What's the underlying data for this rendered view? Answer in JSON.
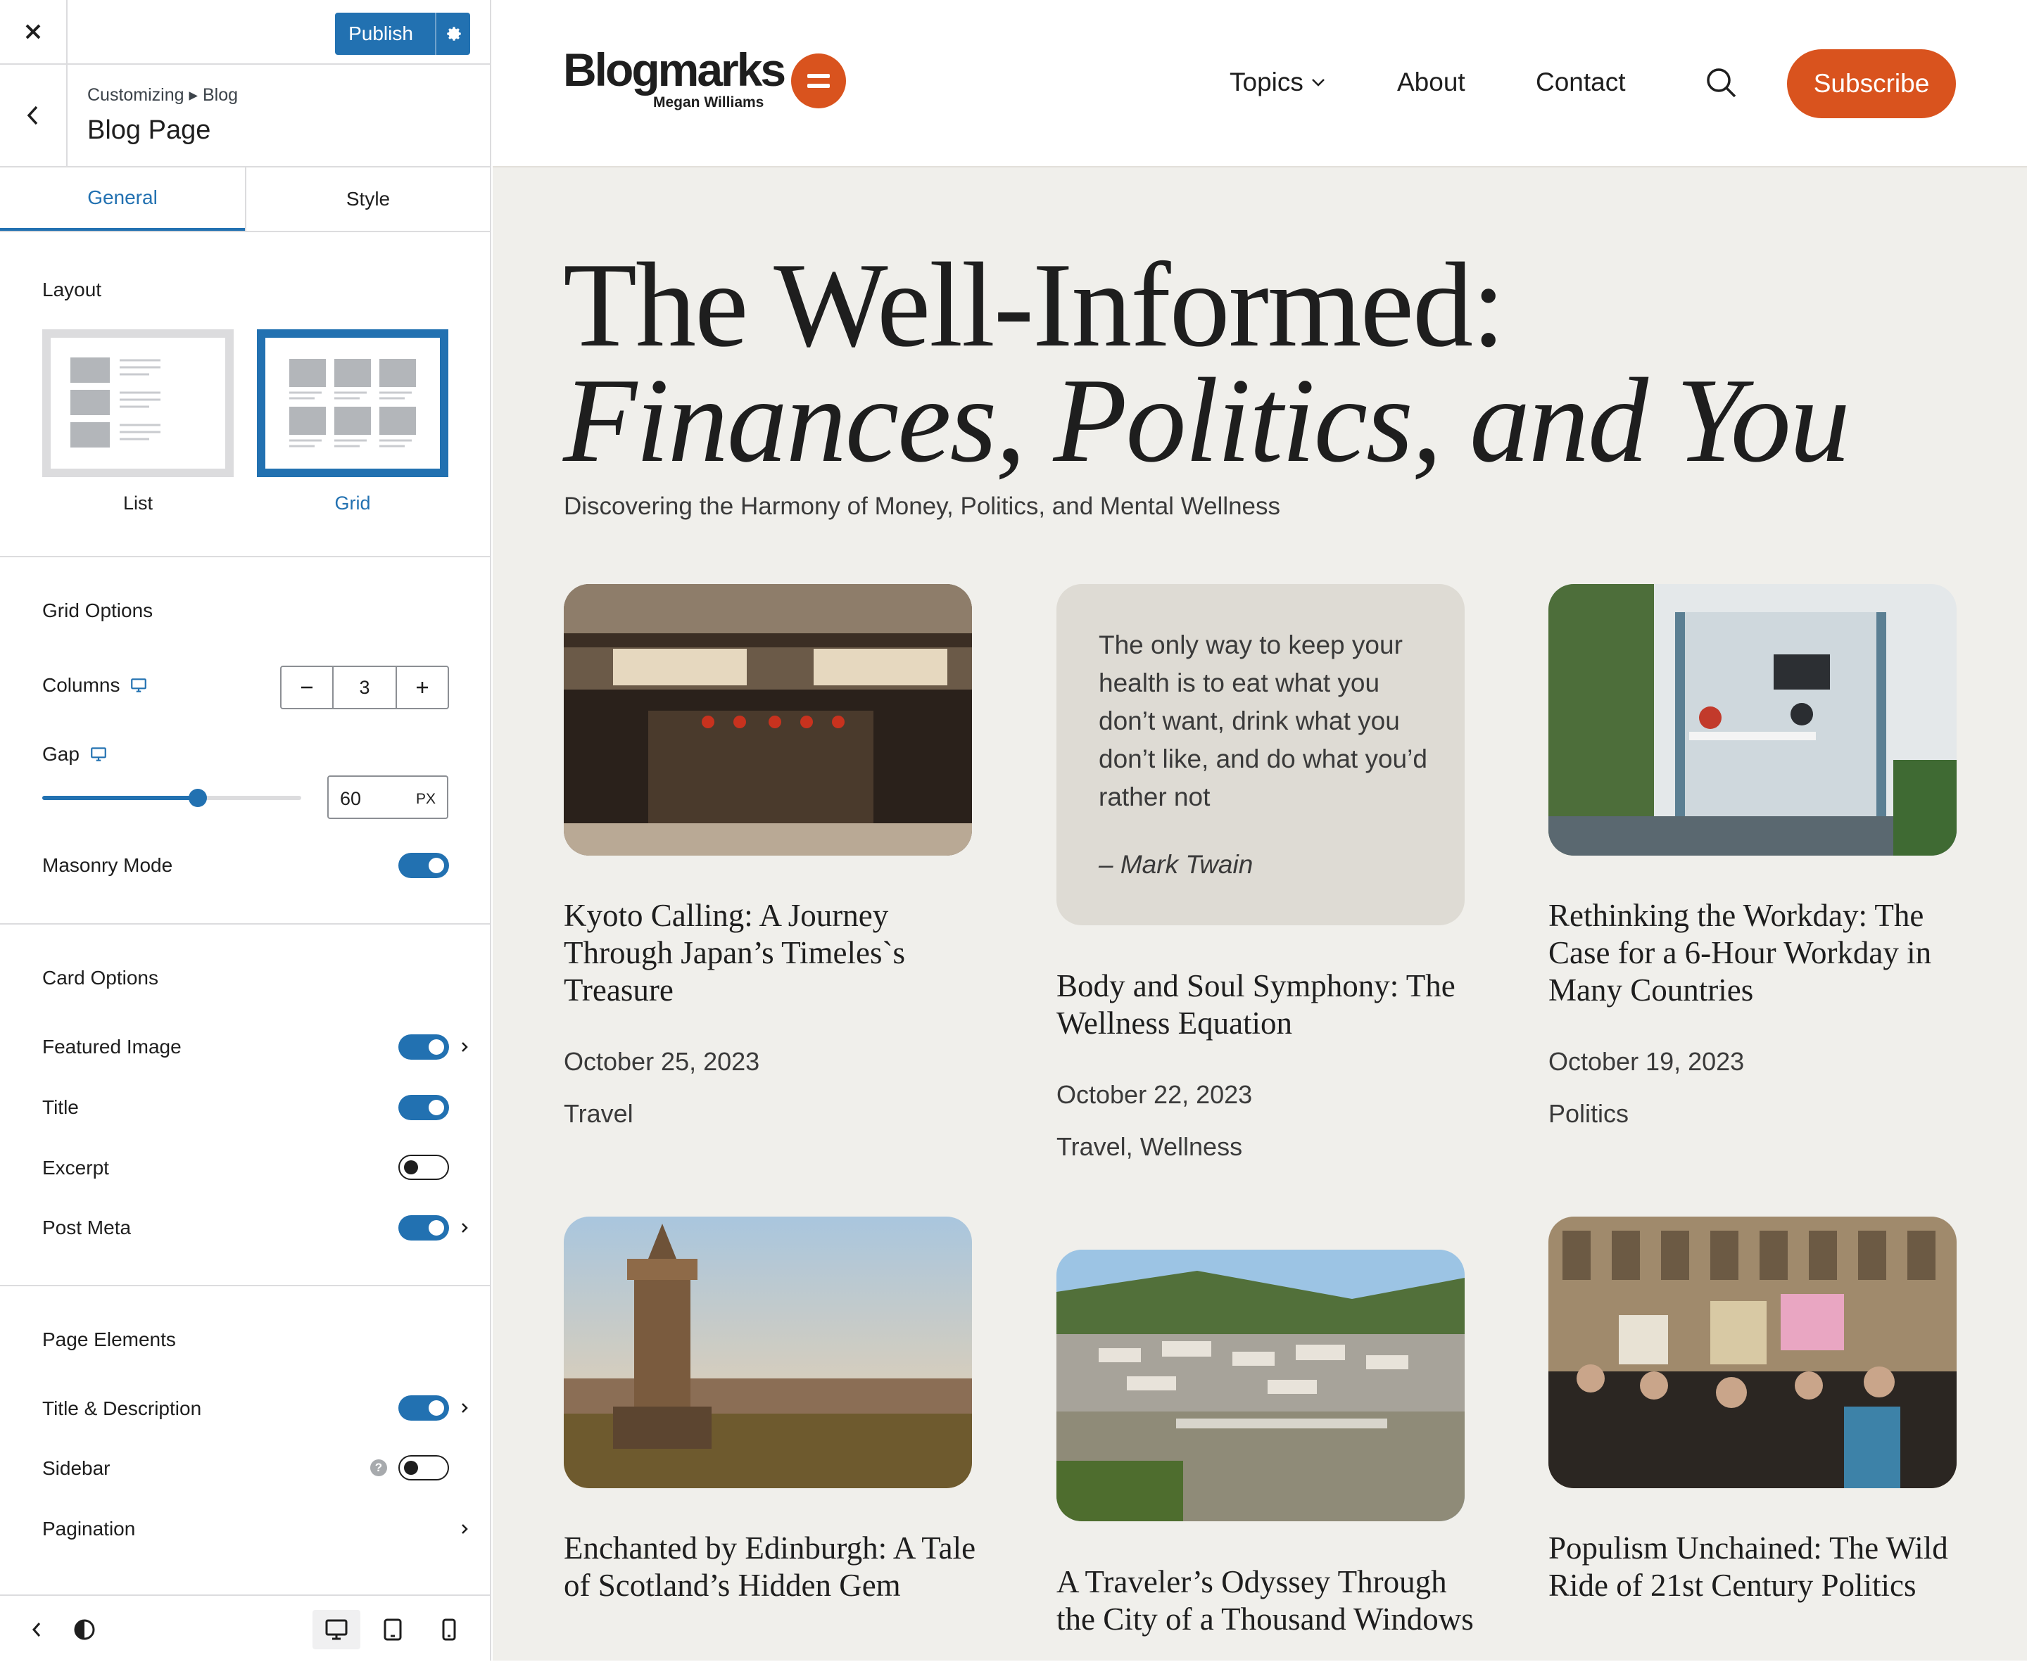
{
  "customizer": {
    "publish_label": "Publish",
    "breadcrumb": "Customizing ▸ Blog",
    "page_title": "Blog Page",
    "tabs": [
      "General",
      "Style"
    ],
    "layout": {
      "title": "Layout",
      "options": [
        "List",
        "Grid"
      ],
      "selected": "Grid"
    },
    "grid_options": {
      "title": "Grid Options",
      "columns_label": "Columns",
      "columns_value": "3",
      "gap_label": "Gap",
      "gap_value": "60",
      "gap_unit": "PX",
      "gap_slider_fraction": 0.6,
      "masonry_label": "Masonry Mode",
      "masonry_on": true
    },
    "card_options": {
      "title": "Card Options",
      "items": [
        {
          "label": "Featured Image",
          "on": true
        },
        {
          "label": "Title",
          "on": true
        },
        {
          "label": "Excerpt",
          "on": false
        },
        {
          "label": "Post Meta",
          "on": true
        }
      ]
    },
    "page_elements": {
      "title": "Page Elements",
      "items": [
        {
          "label": "Title & Description",
          "on": true
        },
        {
          "label": "Sidebar",
          "on": false
        },
        {
          "label": "Pagination"
        }
      ]
    },
    "accent_color": "#2271b1"
  },
  "site": {
    "logo_name": "Blogmarks",
    "logo_author": "Megan Williams",
    "nav": [
      "Topics",
      "About",
      "Contact"
    ],
    "subscribe_label": "Subscribe",
    "brand_color": "#d9531e",
    "hero": {
      "title_line1": "The Well-Informed:",
      "title_line2": "Finances, Politics, and You",
      "subtitle": "Discovering the Harmony of Money, Politics, and Mental Wellness"
    },
    "quote": {
      "text": "The only way to keep your health is to eat what you don’t want, drink what you don’t like, and do what you’d rather not",
      "author": "– Mark Twain"
    },
    "posts": [
      {
        "title": "Kyoto Calling: A Journey Through Japan’s Timeles`s Treasure",
        "date": "October 25, 2023",
        "category": "Travel"
      },
      {
        "title": "Body and Soul Symphony: The Wellness Equation",
        "date": "October 22, 2023",
        "category": "Travel, Wellness"
      },
      {
        "title": "Rethinking the Workday: The Case for a 6-Hour Workday in Many Countries",
        "date": "October 19, 2023",
        "category": "Politics"
      },
      {
        "title": "Enchanted by Edinburgh: A Tale of Scotland’s Hidden Gem"
      },
      {
        "title": "A Traveler’s Odyssey Through the City of a Thousand Windows"
      },
      {
        "title": "Populism Unchained: The Wild Ride of 21st Century Politics"
      }
    ]
  }
}
